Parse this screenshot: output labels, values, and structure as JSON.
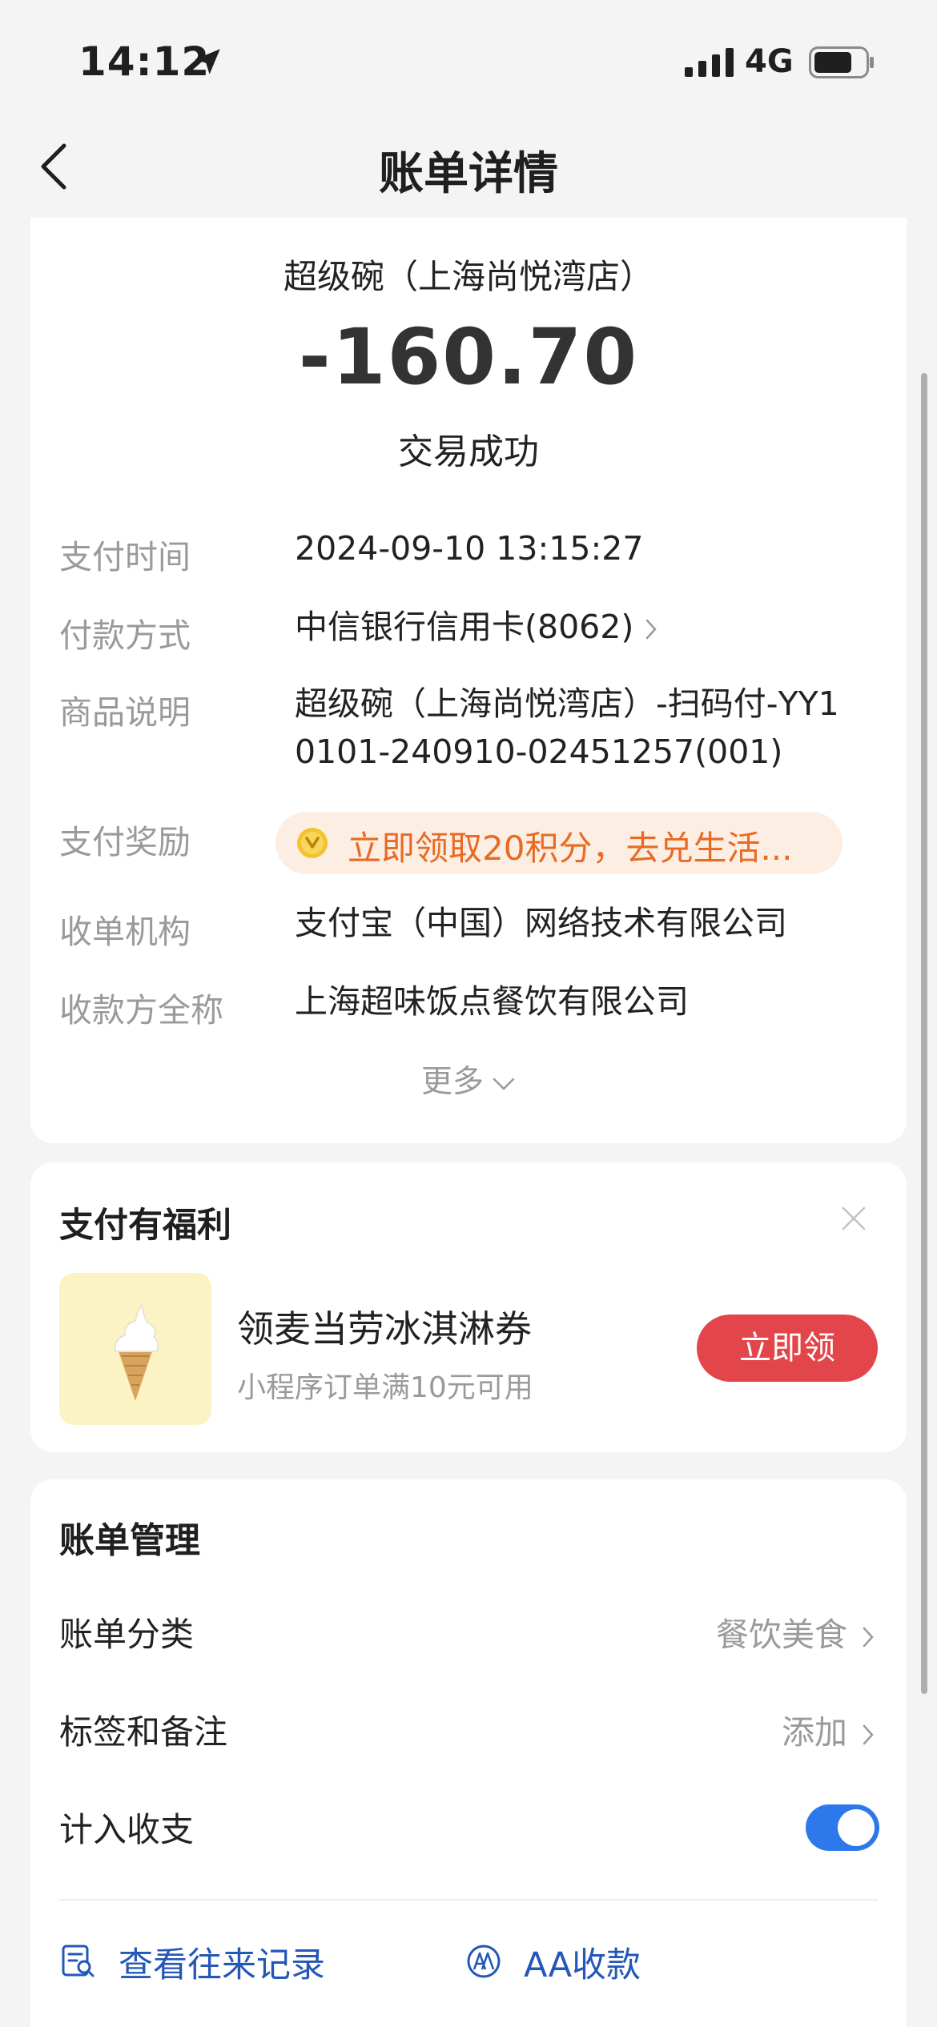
{
  "status_bar": {
    "time": "14:12",
    "network": "4G",
    "icons": [
      "location-arrow-icon",
      "signal-icon",
      "battery-icon"
    ]
  },
  "nav": {
    "title": "账单详情",
    "back_icon": "chevron-left-icon"
  },
  "transaction": {
    "merchant": "超级碗（上海尚悦湾店）",
    "amount": "-160.70",
    "status": "交易成功",
    "details": [
      {
        "label": "支付时间",
        "value": "2024-09-10 13:15:27"
      },
      {
        "label": "付款方式",
        "value": "中信银行信用卡(8062)"
      },
      {
        "label": "商品说明",
        "value_line1": "超级碗（上海尚悦湾店）-扫码付-YY1",
        "value_line2": "0101-240910-02451257(001)"
      },
      {
        "label": "支付奖励",
        "value": "立即领取20积分，去兑生活..."
      },
      {
        "label": "收单机构",
        "value": "支付宝（中国）网络技术有限公司"
      },
      {
        "label": "收款方全称",
        "value": "上海超味饭点餐饮有限公司"
      }
    ],
    "more_label": "更多"
  },
  "benefit": {
    "title": "支付有福利",
    "coupon_title": "领麦当劳冰淇淋券",
    "coupon_subtitle": "小程序订单满10元可用",
    "claim_label": "立即领"
  },
  "management": {
    "title": "账单管理",
    "rows": [
      {
        "label": "账单分类",
        "value": "餐饮美食"
      },
      {
        "label": "标签和备注",
        "value": "添加"
      },
      {
        "label": "计入收支",
        "toggle": true
      }
    ],
    "links": [
      {
        "label": "查看往来记录",
        "icon": "records-search-icon"
      },
      {
        "label": "AA收款",
        "icon": "aa-collect-icon"
      }
    ]
  },
  "colors": {
    "accent_blue": "#2d79ec",
    "link_blue": "#2457b8",
    "reward_orange": "#e86a24",
    "claim_red": "#e2464a"
  }
}
